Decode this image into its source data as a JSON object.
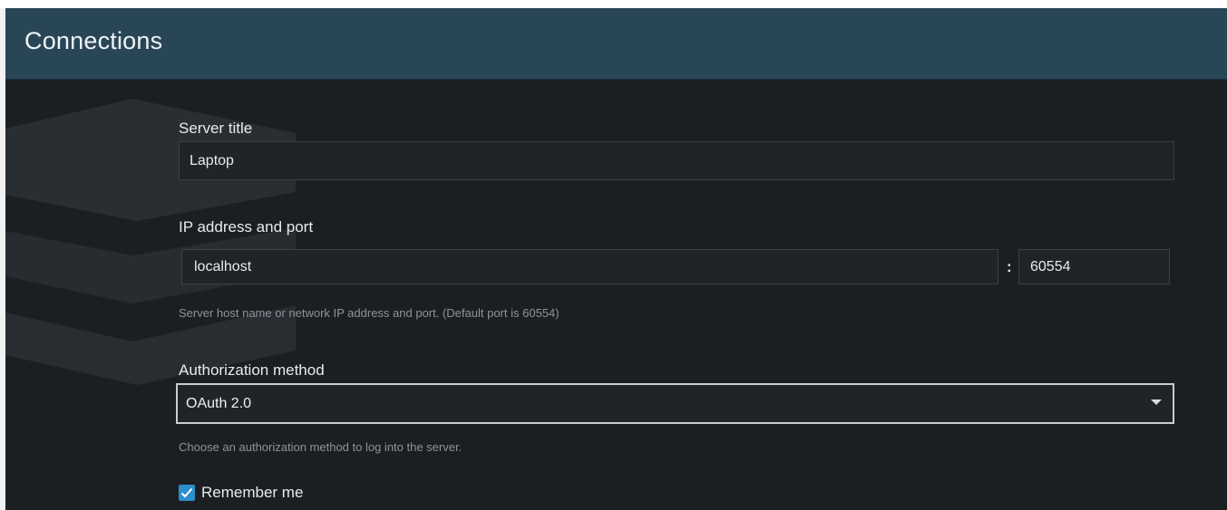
{
  "window": {
    "title": "Connections"
  },
  "form": {
    "server_title": {
      "label": "Server title",
      "value": "Laptop"
    },
    "address": {
      "label": "IP address and port",
      "host_value": "localhost",
      "separator": ":",
      "port_value": "60554",
      "hint": "Server host name or network IP address and port. (Default port is 60554)"
    },
    "auth": {
      "label": "Authorization method",
      "selected": "OAuth 2.0",
      "hint": "Choose an authorization method to log into the server."
    },
    "remember_me": {
      "label": "Remember me",
      "checked": true
    }
  },
  "icons": {
    "dropdown": "caret-down-icon",
    "checkbox": "checkmark-icon"
  },
  "colors": {
    "header_bg": "#294657",
    "panel_bg": "#1c1f22",
    "accent": "#2b8fcb"
  }
}
